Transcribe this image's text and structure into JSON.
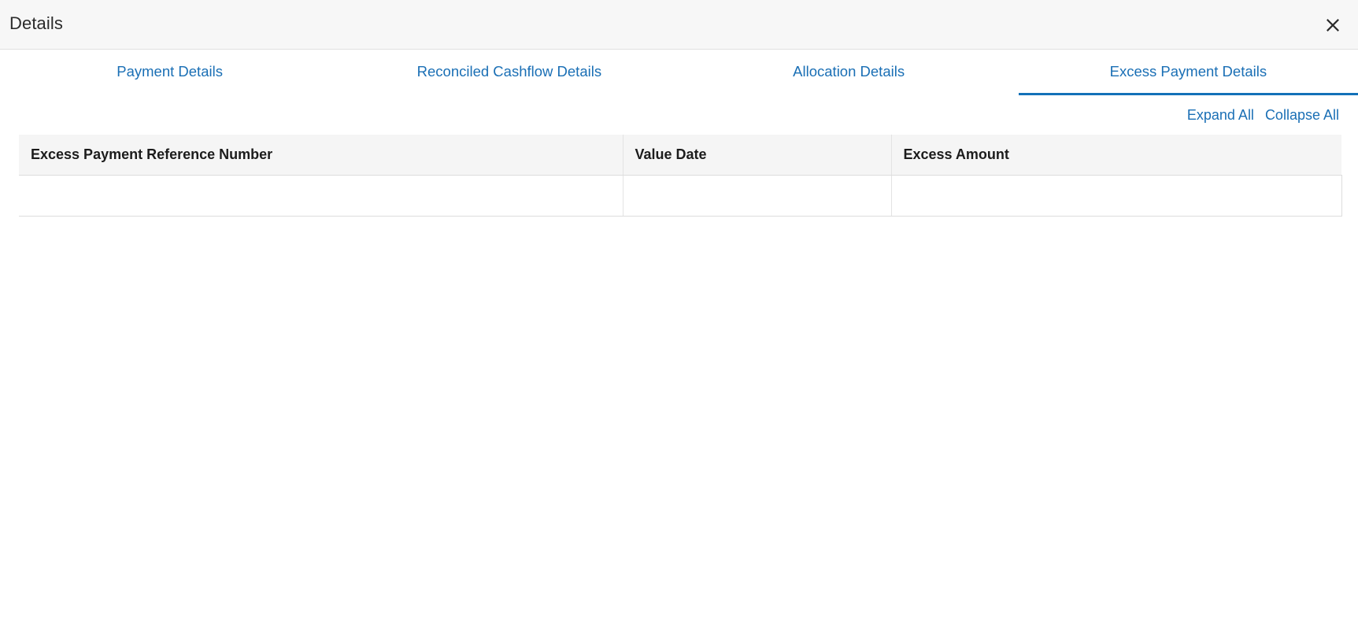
{
  "window": {
    "title": "Details",
    "close_icon": "close-icon",
    "close_label": "×"
  },
  "tabs": {
    "items": [
      {
        "label": "Payment Details",
        "active": false
      },
      {
        "label": "Reconciled Cashflow Details",
        "active": false
      },
      {
        "label": "Allocation Details",
        "active": false
      },
      {
        "label": "Excess Payment Details",
        "active": true
      }
    ],
    "active_index": 3,
    "active_color": "#1371b8",
    "link_color": "#1a6fb5"
  },
  "toolbar": {
    "expand_all_label": "Expand All",
    "collapse_all_label": "Collapse All"
  },
  "table": {
    "columns": [
      "Excess Payment Reference Number",
      "Value Date",
      "Excess Amount"
    ],
    "rows": [
      {
        "reference_number": "",
        "value_date": "",
        "excess_amount": ""
      }
    ],
    "header_background": "#f5f5f5",
    "border_color": "#dcdcdc"
  }
}
